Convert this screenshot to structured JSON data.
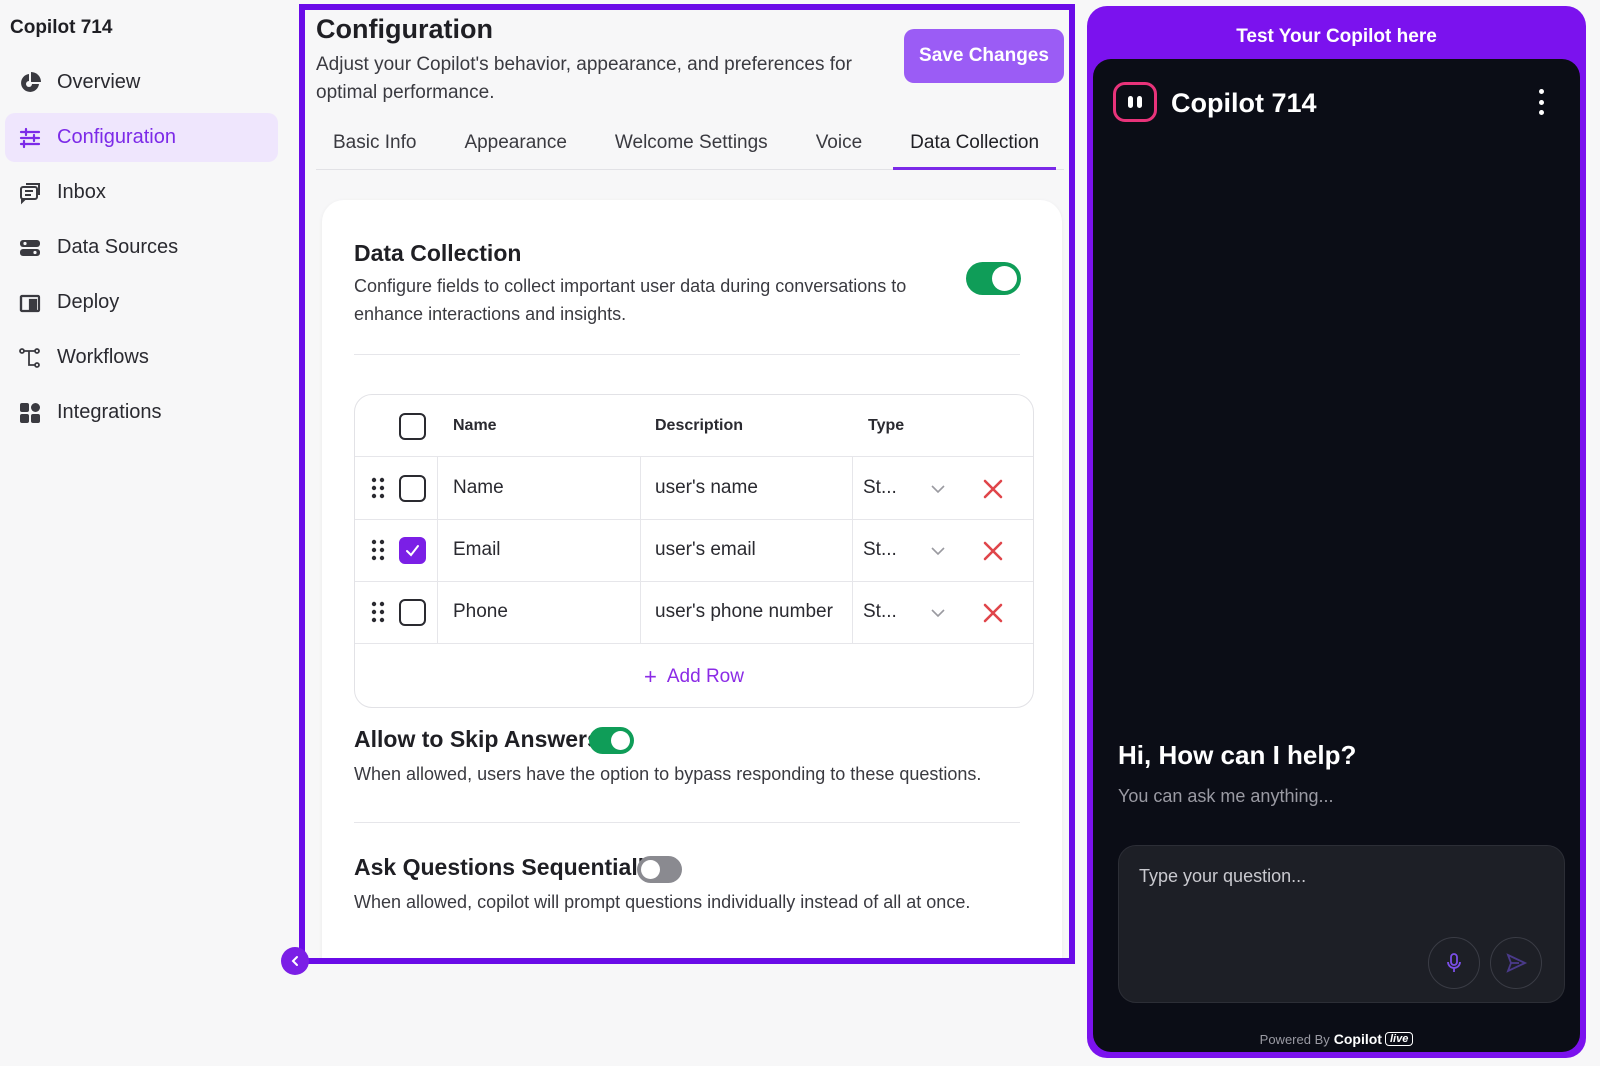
{
  "sidebar": {
    "brand": "Copilot 714",
    "items": [
      {
        "label": "Overview",
        "icon": "pie-chart-icon"
      },
      {
        "label": "Configuration",
        "icon": "sliders-icon"
      },
      {
        "label": "Inbox",
        "icon": "inbox-icon"
      },
      {
        "label": "Data Sources",
        "icon": "database-icon"
      },
      {
        "label": "Deploy",
        "icon": "deploy-icon"
      },
      {
        "label": "Workflows",
        "icon": "workflow-icon"
      },
      {
        "label": "Integrations",
        "icon": "grid-icon"
      }
    ],
    "active": "Configuration"
  },
  "header": {
    "title": "Configuration",
    "subtitle": "Adjust your Copilot's behavior, appearance, and preferences for optimal performance.",
    "save_label": "Save Changes"
  },
  "tabs": [
    {
      "label": "Basic Info"
    },
    {
      "label": "Appearance"
    },
    {
      "label": "Welcome Settings"
    },
    {
      "label": "Voice"
    },
    {
      "label": "Data Collection"
    }
  ],
  "active_tab": "Data Collection",
  "data_collection": {
    "title": "Data Collection",
    "description": "Configure fields to collect important user data during conversations to enhance interactions and insights.",
    "enabled": true,
    "table": {
      "headers": {
        "name": "Name",
        "description": "Description",
        "type": "Type"
      },
      "rows": [
        {
          "name": "Name",
          "description": "user's name",
          "type": "St...",
          "checked": false
        },
        {
          "name": "Email",
          "description": "user's email",
          "type": "St...",
          "checked": true
        },
        {
          "name": "Phone",
          "description": "user's phone number",
          "type": "St...",
          "checked": false
        }
      ],
      "add_row_label": "Add Row"
    }
  },
  "skip_answers": {
    "title": "Allow to Skip Answers",
    "description": "When allowed, users have the option to bypass responding to these questions.",
    "enabled": true
  },
  "sequential": {
    "title": "Ask Questions Sequentially",
    "description": "When allowed, copilot will prompt questions individually instead of all at once.",
    "enabled": false
  },
  "preview": {
    "header": "Test Your Copilot here",
    "bot_name": "Copilot 714",
    "greeting": "Hi, How can I help?",
    "greeting_sub": "You can ask me anything...",
    "input_placeholder": "Type your question...",
    "powered_by": "Powered By",
    "powered_brand": "Copilot",
    "powered_badge": "live"
  },
  "colors": {
    "accent": "#7b1fe6",
    "frame": "#6a0be8",
    "toggle_on": "#0f9d58",
    "delete": "#e0454a",
    "chat_bg": "#0b0d16"
  }
}
